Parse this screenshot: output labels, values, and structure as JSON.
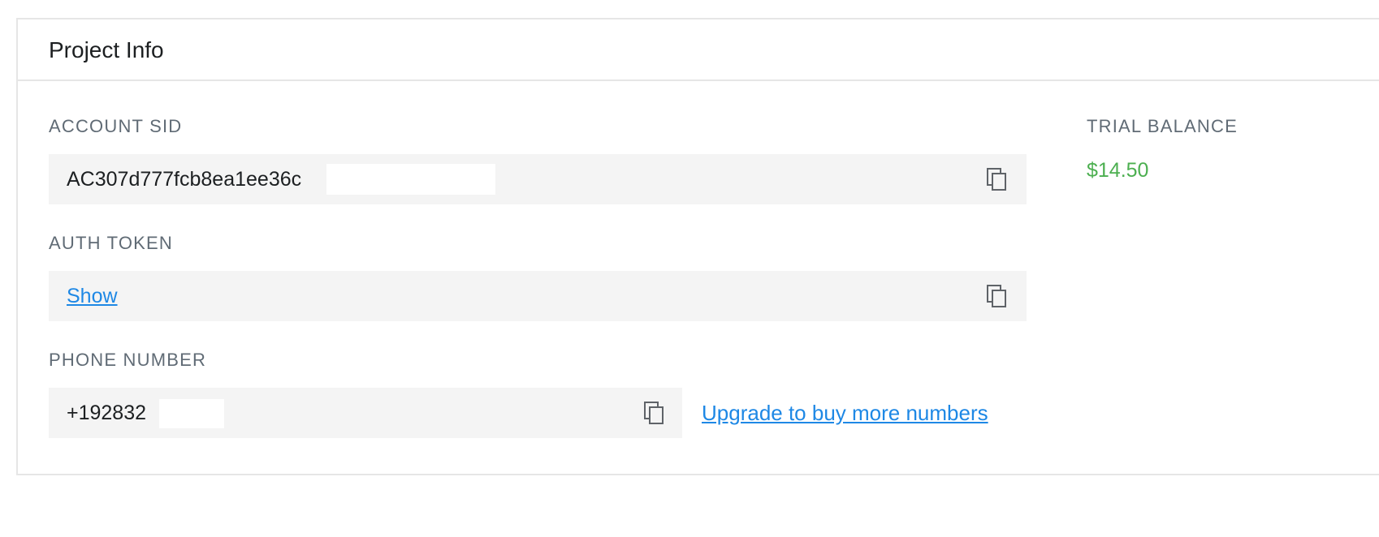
{
  "panel": {
    "title": "Project Info"
  },
  "account_sid": {
    "label": "ACCOUNT SID",
    "value": "AC307d777fcb8ea1ee36c",
    "copy_icon": "copy-icon"
  },
  "auth_token": {
    "label": "AUTH TOKEN",
    "show_label": "Show",
    "copy_icon": "copy-icon"
  },
  "phone_number": {
    "label": "PHONE NUMBER",
    "value": "+192832",
    "copy_icon": "copy-icon",
    "upgrade_label": "Upgrade to buy more numbers"
  },
  "trial_balance": {
    "label": "TRIAL BALANCE",
    "value": "$14.50"
  },
  "colors": {
    "link": "#1e88e5",
    "balance": "#4caf50",
    "field_bg": "#f4f4f4",
    "label": "#606b75"
  }
}
